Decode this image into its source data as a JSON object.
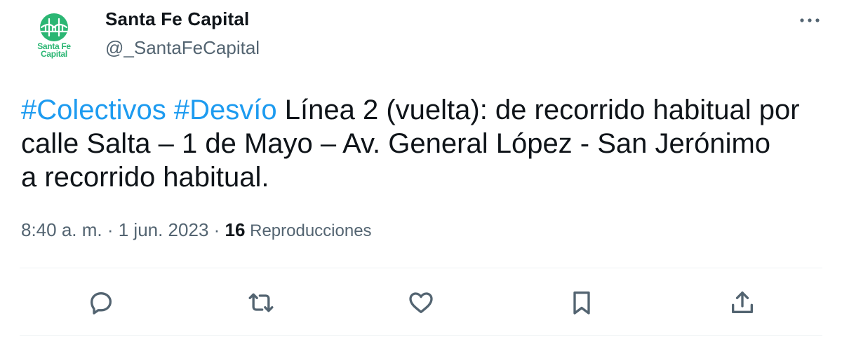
{
  "author": {
    "display_name": "Santa Fe Capital",
    "handle": "@_SantaFeCapital",
    "avatar_text_line1": "Santa Fe",
    "avatar_text_line2": "Capital",
    "brand_color": "#2bb673"
  },
  "tweet": {
    "hashtag_1": "#Colectivos",
    "hashtag_2": "#Desvío",
    "body": " Línea 2 (vuelta): de recorrido habitual por calle Salta – 1 de Mayo – Av. General López - San Jerónimo   a recorrido habitual."
  },
  "meta": {
    "time": "8:40 a. m.",
    "separator_1": " · ",
    "date": "1 jun. 2023",
    "separator_2": " · ",
    "views_count": "16",
    "views_label": " Reproducciones"
  },
  "actions": {
    "reply_icon": "reply-icon",
    "retweet_icon": "retweet-icon",
    "like_icon": "heart-icon",
    "bookmark_icon": "bookmark-icon",
    "share_icon": "share-icon"
  },
  "colors": {
    "text": "#0f1419",
    "secondary": "#536471",
    "link": "#1d9bf0",
    "divider": "#eff3f4"
  }
}
